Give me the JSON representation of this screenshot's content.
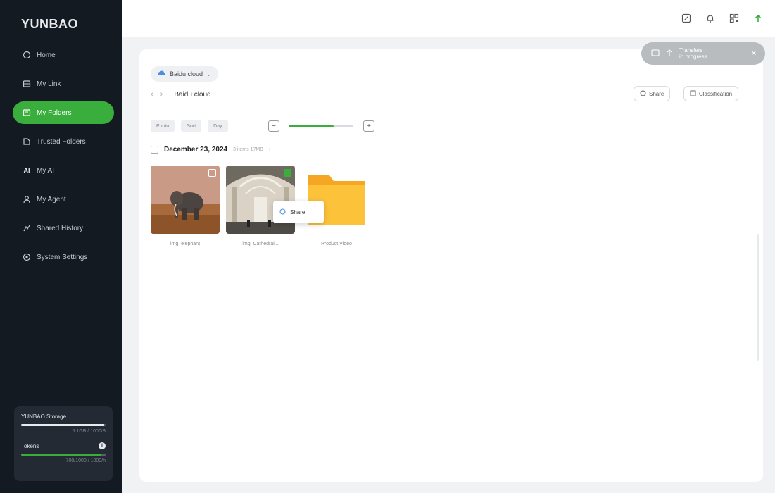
{
  "app": {
    "logo": "YUNBAO"
  },
  "sidebar": {
    "items": [
      {
        "label": "Home",
        "icon": "home-icon"
      },
      {
        "label": "My Link",
        "icon": "link-icon"
      },
      {
        "label": "My Folders",
        "icon": "folder-icon",
        "active": true
      },
      {
        "label": "Trusted Folders",
        "icon": "trusted-folder-icon"
      },
      {
        "label": "My AI",
        "icon": "ai-icon"
      },
      {
        "label": "My Agent",
        "icon": "agent-icon"
      },
      {
        "label": "Shared History",
        "icon": "share-history-icon"
      },
      {
        "label": "System Settings",
        "icon": "settings-icon"
      }
    ],
    "storage": {
      "label": "YUNBAO Storage",
      "detail": "6.1GB / 100GB",
      "fraction": 0.98
    },
    "tokens": {
      "label": "Tokens",
      "detail": "700/1000 / 1000/h",
      "fraction": 0.95
    }
  },
  "topbar": {
    "icons": [
      "edit-icon",
      "bell-icon",
      "qr-code-icon",
      "upload-icon"
    ]
  },
  "notification_pill": {
    "text_line1": "Transfers",
    "text_line2": "in progress"
  },
  "source_selector": {
    "label": "Baidu cloud"
  },
  "breadcrumb": {
    "current": "Baidu cloud"
  },
  "actions": {
    "share_label": "Share",
    "classification_label": "Classification"
  },
  "filters": [
    "Photo",
    "Sort",
    "Day"
  ],
  "zoom": {
    "level": 0.7
  },
  "group": {
    "date": "December 23, 2024",
    "count": "3 items 17MB"
  },
  "files": [
    {
      "name": "img_elephant",
      "type": "image-elephant"
    },
    {
      "name": "img_Cathedral...",
      "type": "image-cathedral"
    },
    {
      "name": "Product Video",
      "type": "folder"
    }
  ],
  "context_menu": {
    "share_label": "Share"
  },
  "colors": {
    "accent": "#3aae3d",
    "sidebar_bg": "#141a22",
    "folder": "#fbbf24"
  }
}
